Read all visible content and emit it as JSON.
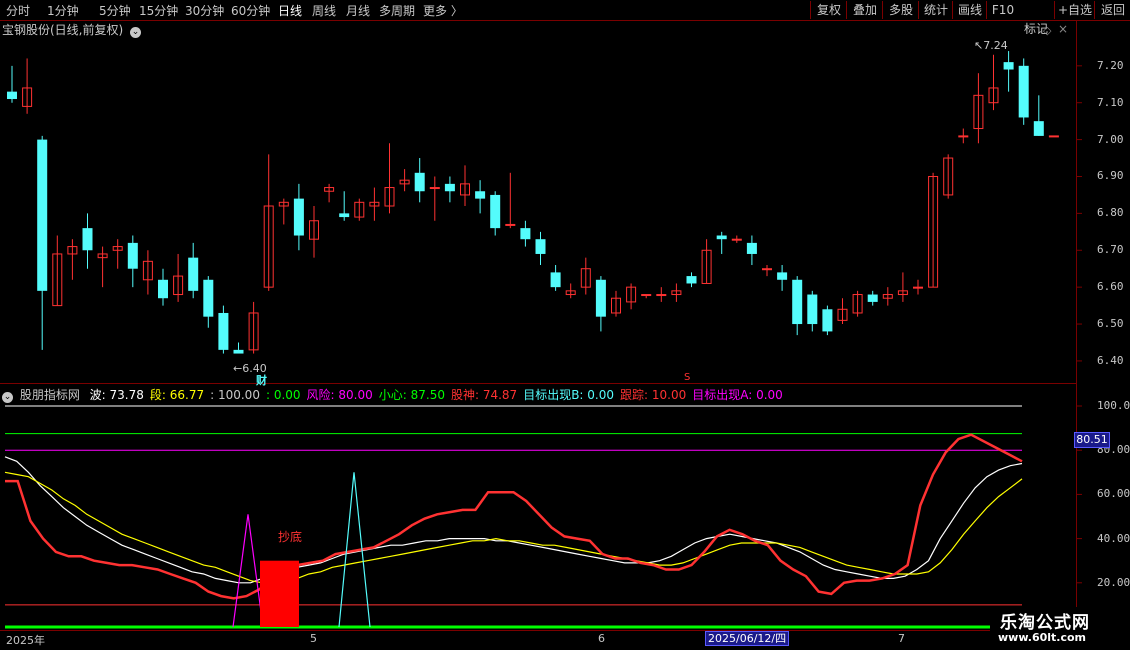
{
  "toolbar": {
    "periods": [
      "分时",
      "1分钟",
      "5分钟",
      "15分钟",
      "30分钟",
      "60分钟",
      "日线",
      "周线",
      "月线",
      "多周期",
      "更多 〉"
    ],
    "active_period": "日线",
    "right_buttons": [
      "复权",
      "叠加",
      "多股",
      "统计",
      "画线",
      "F10",
      "+自选",
      "返回"
    ],
    "mark_label": "标记"
  },
  "main_chart": {
    "title": "宝钢股份(日线,前复权)",
    "expand_icon": "chevron-down-circle-icon",
    "high_label": "7.24",
    "low_label": "6.40",
    "cai_marker": "财",
    "s_marker": "S",
    "y_ticks": [
      "7.20",
      "7.10",
      "7.00",
      "6.90",
      "6.80",
      "6.70",
      "6.60",
      "6.50",
      "6.40"
    ],
    "ylim": [
      6.37,
      7.27
    ],
    "up_color": "#ff3232",
    "down_color": "#54fcfc"
  },
  "sub_chart": {
    "title": "股朋指标网",
    "values": [
      {
        "label": "波:",
        "value": "73.78",
        "color": "#ffffff"
      },
      {
        "label": "段:",
        "value": "66.77",
        "color": "#ffff00"
      },
      {
        "label": "",
        "value": ": 100.00",
        "color": "#c8c8c8"
      },
      {
        "label": "",
        "value": ": 0.00",
        "color": "#00ff00"
      },
      {
        "label": "风险:",
        "value": "80.00",
        "color": "#ff00ff"
      },
      {
        "label": "小心:",
        "value": "87.50",
        "color": "#00ff00"
      },
      {
        "label": "股神:",
        "value": "74.87",
        "color": "#ff3232"
      },
      {
        "label": "目标出现B:",
        "value": "0.00",
        "color": "#54fcfc"
      },
      {
        "label": "跟踪:",
        "value": "10.00",
        "color": "#ff3232"
      },
      {
        "label": "目标出现A:",
        "value": "0.00",
        "color": "#ff00ff"
      }
    ],
    "signal_label": "抄底",
    "y_ticks": [
      "100.0",
      "80.00",
      "60.00",
      "40.00",
      "20.00"
    ],
    "current_value": "80.51",
    "ylim": [
      0,
      105
    ]
  },
  "x_axis": {
    "labels": [
      "2025年",
      "5",
      "6",
      "7"
    ],
    "cursor_date": "2025/06/12/四"
  },
  "watermark": {
    "title": "乐淘公式网",
    "url": "www.60lt.com"
  },
  "chart_data": [
    {
      "type": "candlestick",
      "title": "宝钢股份(日线,前复权)",
      "ylim": [
        6.37,
        7.27
      ],
      "candles": [
        [
          7.13,
          7.11,
          7.2,
          7.1
        ],
        [
          7.09,
          7.14,
          7.22,
          7.07
        ],
        [
          7.0,
          6.59,
          7.01,
          6.43
        ],
        [
          6.55,
          6.69,
          6.74,
          6.55
        ],
        [
          6.69,
          6.71,
          6.73,
          6.62
        ],
        [
          6.76,
          6.7,
          6.8,
          6.65
        ],
        [
          6.68,
          6.69,
          6.71,
          6.6
        ],
        [
          6.7,
          6.71,
          6.73,
          6.65
        ],
        [
          6.72,
          6.65,
          6.74,
          6.6
        ],
        [
          6.62,
          6.67,
          6.7,
          6.58
        ],
        [
          6.62,
          6.57,
          6.65,
          6.55
        ],
        [
          6.58,
          6.63,
          6.69,
          6.56
        ],
        [
          6.68,
          6.59,
          6.72,
          6.57
        ],
        [
          6.62,
          6.52,
          6.63,
          6.49
        ],
        [
          6.53,
          6.43,
          6.55,
          6.42
        ],
        [
          6.43,
          6.42,
          6.45,
          6.42
        ],
        [
          6.43,
          6.53,
          6.56,
          6.42
        ],
        [
          6.6,
          6.82,
          6.96,
          6.59
        ],
        [
          6.82,
          6.83,
          6.84,
          6.77
        ],
        [
          6.84,
          6.74,
          6.88,
          6.7
        ],
        [
          6.73,
          6.78,
          6.82,
          6.68
        ],
        [
          6.86,
          6.87,
          6.88,
          6.83
        ],
        [
          6.8,
          6.79,
          6.86,
          6.78
        ],
        [
          6.79,
          6.83,
          6.84,
          6.78
        ],
        [
          6.82,
          6.83,
          6.87,
          6.78
        ],
        [
          6.82,
          6.87,
          6.99,
          6.8
        ],
        [
          6.88,
          6.89,
          6.92,
          6.86
        ],
        [
          6.91,
          6.86,
          6.95,
          6.83
        ],
        [
          6.87,
          6.87,
          6.9,
          6.78
        ],
        [
          6.88,
          6.86,
          6.9,
          6.83
        ],
        [
          6.85,
          6.88,
          6.93,
          6.82
        ],
        [
          6.86,
          6.84,
          6.89,
          6.8
        ],
        [
          6.85,
          6.76,
          6.86,
          6.74
        ],
        [
          6.77,
          6.77,
          6.91,
          6.76
        ],
        [
          6.76,
          6.73,
          6.78,
          6.71
        ],
        [
          6.73,
          6.69,
          6.75,
          6.66
        ],
        [
          6.64,
          6.6,
          6.66,
          6.59
        ],
        [
          6.58,
          6.59,
          6.61,
          6.57
        ],
        [
          6.6,
          6.65,
          6.68,
          6.58
        ],
        [
          6.62,
          6.52,
          6.63,
          6.48
        ],
        [
          6.53,
          6.57,
          6.59,
          6.52
        ],
        [
          6.56,
          6.6,
          6.61,
          6.54
        ],
        [
          6.58,
          6.58,
          6.58,
          6.57
        ],
        [
          6.58,
          6.58,
          6.6,
          6.56
        ],
        [
          6.58,
          6.59,
          6.61,
          6.56
        ],
        [
          6.63,
          6.61,
          6.64,
          6.6
        ],
        [
          6.61,
          6.7,
          6.73,
          6.61
        ],
        [
          6.74,
          6.73,
          6.75,
          6.69
        ],
        [
          6.73,
          6.73,
          6.74,
          6.72
        ],
        [
          6.72,
          6.69,
          6.74,
          6.66
        ],
        [
          6.65,
          6.65,
          6.66,
          6.63
        ],
        [
          6.64,
          6.62,
          6.66,
          6.59
        ],
        [
          6.62,
          6.5,
          6.63,
          6.47
        ],
        [
          6.58,
          6.5,
          6.59,
          6.48
        ],
        [
          6.54,
          6.48,
          6.55,
          6.47
        ],
        [
          6.51,
          6.54,
          6.57,
          6.5
        ],
        [
          6.53,
          6.58,
          6.59,
          6.52
        ],
        [
          6.58,
          6.56,
          6.59,
          6.55
        ],
        [
          6.57,
          6.58,
          6.6,
          6.55
        ],
        [
          6.58,
          6.59,
          6.64,
          6.56
        ],
        [
          6.6,
          6.6,
          6.62,
          6.58
        ],
        [
          6.6,
          6.9,
          6.91,
          6.6
        ],
        [
          6.85,
          6.95,
          6.96,
          6.84
        ],
        [
          7.01,
          7.01,
          7.03,
          6.99
        ],
        [
          7.03,
          7.12,
          7.18,
          6.99
        ],
        [
          7.1,
          7.14,
          7.23,
          7.08
        ],
        [
          7.21,
          7.19,
          7.24,
          7.13
        ],
        [
          7.2,
          7.06,
          7.22,
          7.04
        ],
        [
          7.05,
          7.01,
          7.12,
          7.01
        ],
        [
          7.01,
          7.01,
          7.01,
          7.01
        ]
      ]
    },
    {
      "type": "line",
      "title": "股朋指标网",
      "ylim": [
        0,
        105
      ],
      "series": [
        {
          "name": "波",
          "color": "#ffffff",
          "values": [
            77,
            75,
            70,
            64,
            59,
            54,
            50,
            46,
            43,
            40,
            37,
            35,
            33,
            31,
            29,
            27,
            25,
            24,
            22,
            21,
            20,
            20,
            22,
            24,
            26,
            27,
            28,
            29,
            31,
            33,
            34,
            35,
            36,
            37,
            37,
            38,
            39,
            39,
            40,
            40,
            40,
            40,
            39,
            39,
            38,
            37,
            36,
            35,
            34,
            33,
            32,
            31,
            30,
            29,
            29,
            29,
            30,
            32,
            35,
            38,
            40,
            41,
            42,
            41,
            40,
            39,
            38,
            36,
            34,
            31,
            28,
            26,
            25,
            24,
            23,
            22,
            22,
            23,
            26,
            30,
            40,
            48,
            56,
            63,
            68,
            71,
            73,
            74
          ]
        },
        {
          "name": "段",
          "color": "#ffff00",
          "values": [
            70,
            69,
            68,
            65,
            62,
            58,
            55,
            51,
            48,
            45,
            42,
            40,
            38,
            36,
            34,
            32,
            30,
            28,
            27,
            25,
            23,
            21,
            20,
            20,
            21,
            22,
            24,
            25,
            27,
            28,
            29,
            30,
            31,
            32,
            33,
            34,
            35,
            36,
            37,
            38,
            39,
            39,
            40,
            39,
            39,
            38,
            37,
            37,
            36,
            35,
            34,
            33,
            32,
            31,
            30,
            29,
            28,
            28,
            29,
            31,
            33,
            35,
            37,
            38,
            38,
            38,
            38,
            37,
            36,
            34,
            32,
            30,
            28,
            27,
            26,
            25,
            24,
            24,
            24,
            25,
            29,
            35,
            42,
            48,
            54,
            59,
            63,
            67
          ]
        },
        {
          "name": "股神",
          "color": "#ff3232",
          "values": [
            66,
            66,
            48,
            40,
            34,
            32,
            32,
            30,
            29,
            28,
            28,
            27,
            26,
            24,
            22,
            20,
            16,
            14,
            13,
            14,
            17,
            22,
            25,
            28,
            29,
            30,
            33,
            34,
            35,
            36,
            39,
            42,
            46,
            49,
            51,
            52,
            53,
            53,
            61,
            61,
            61,
            57,
            51,
            45,
            41,
            40,
            39,
            33,
            31,
            31,
            29,
            28,
            26,
            26,
            28,
            34,
            41,
            44,
            42,
            39,
            37,
            30,
            26,
            23,
            16,
            15,
            20,
            21,
            21,
            22,
            24,
            28,
            55,
            69,
            79,
            85,
            87,
            84,
            81,
            78,
            75
          ]
        }
      ],
      "lines": {
        "100": "#ffffff",
        "87.5": "#00ff00",
        "80": "#ff00ff",
        "10": "#ff3232",
        "0": "#00ff00"
      },
      "signals": [
        {
          "name": "目标出现A",
          "color": "#ff00ff",
          "peak": 51
        },
        {
          "name": "目标出现B",
          "color": "#54fcfc",
          "peak": 70
        },
        {
          "name": "抄底",
          "color": "#ff0000",
          "value": 30
        }
      ]
    }
  ]
}
